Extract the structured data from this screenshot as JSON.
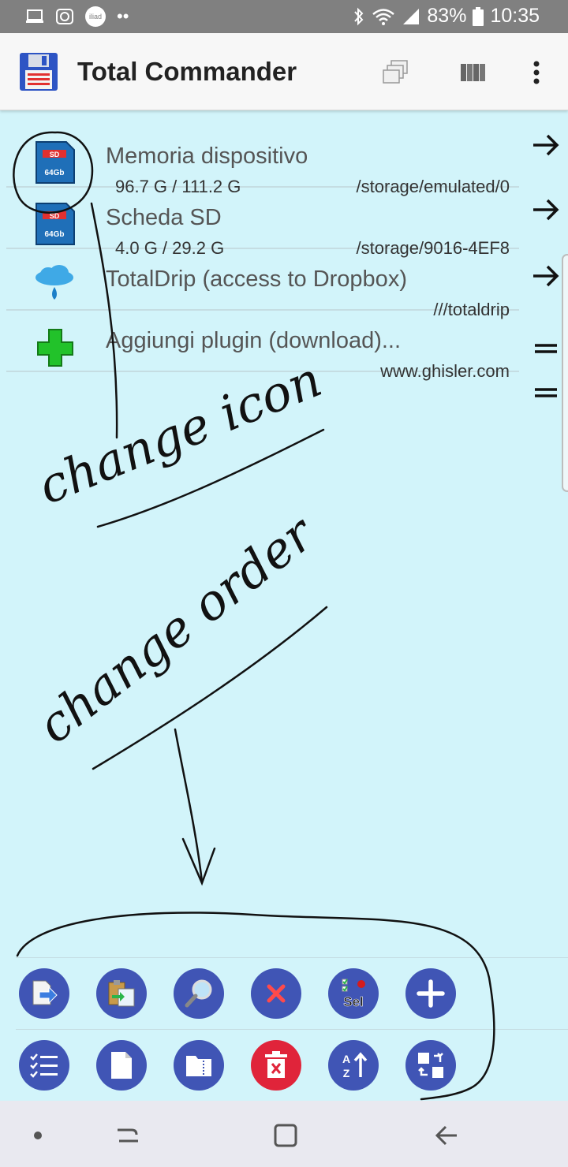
{
  "status_bar": {
    "battery": "83%",
    "time": "10:35",
    "carrier_badge": "iliad"
  },
  "app": {
    "title": "Total Commander"
  },
  "entries": [
    {
      "name": "Memoria dispositivo",
      "size": "96.7 G / 111.2 G",
      "path": "/storage/emulated/0",
      "icon": "sd-card-icon",
      "badge": "64Gb"
    },
    {
      "name": "Scheda SD",
      "size": "4.0 G / 29.2 G",
      "path": "/storage/9016-4EF8",
      "icon": "sd-card-icon",
      "badge": "64Gb"
    },
    {
      "name": "TotalDrip (access to Dropbox)",
      "size": "",
      "path": "///totaldrip",
      "icon": "cloud-icon"
    },
    {
      "name": "Aggiungi plugin (download)...",
      "size": "",
      "path": "www.ghisler.com",
      "icon": "plus-icon"
    }
  ],
  "annotations": {
    "note1": "change icon",
    "note2": "change order"
  },
  "toolbar": {
    "sel_label": "Sel",
    "sort_label": "A Z"
  },
  "colors": {
    "background": "#d2f4fa",
    "button_blue": "#4055b5",
    "button_red": "#e0243a",
    "status_bar": "#808080"
  }
}
